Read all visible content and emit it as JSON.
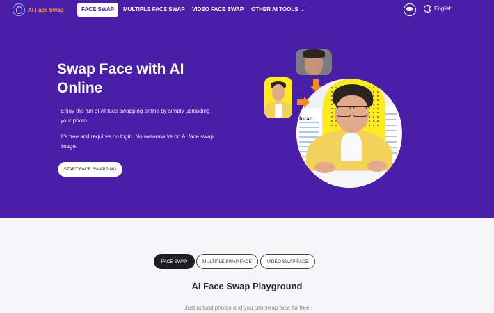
{
  "brand": {
    "logo_text": "AI Face Swap",
    "accent": "#4a1fa8",
    "logo_color": "#f6a04a"
  },
  "nav": {
    "tabs": [
      {
        "label": "FACE SWAP",
        "active": true
      },
      {
        "label": "MULTIPLE FACE SWAP",
        "active": false
      },
      {
        "label": "VIDEO FACE SWAP",
        "active": false
      },
      {
        "label": "OTHER AI TOOLS",
        "active": false,
        "has_dropdown": true
      }
    ],
    "discord_icon": "discord-icon",
    "language": "English"
  },
  "hero": {
    "title": "Swap Face with AI Online",
    "paragraph1": "Enjoy the fun of AI face swapping online by simply uploading your photo.",
    "paragraph2": "It's free and requires no login. No watermarks on AI face swap image.",
    "cta_label": "START FACE SWAPPING",
    "image_caption": "Inran"
  },
  "playground": {
    "tabs": [
      {
        "label": "FACE SWAP",
        "active": true
      },
      {
        "label": "MULTIPLE SWAP FACE",
        "active": false
      },
      {
        "label": "VIDEO SWAP FACE",
        "active": false
      }
    ],
    "title": "AI Face Swap Playground",
    "subtitle": "Just upload photos and you can swap face for free"
  }
}
